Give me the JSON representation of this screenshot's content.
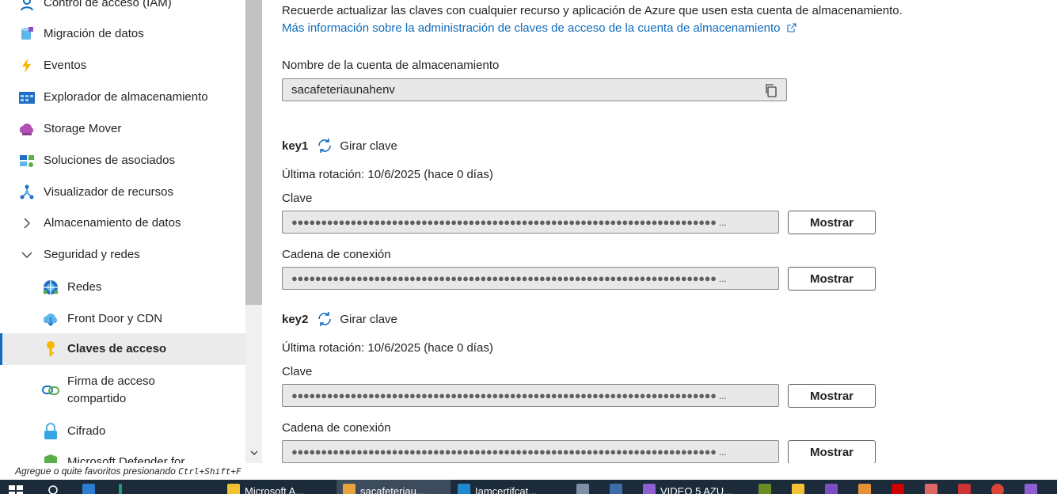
{
  "sidebar": {
    "items": [
      {
        "label": "Control de acceso (IAM)",
        "icon": "access-control-icon"
      },
      {
        "label": "Migración de datos",
        "icon": "data-migration-icon"
      },
      {
        "label": "Eventos",
        "icon": "events-icon"
      },
      {
        "label": "Explorador de almacenamiento",
        "icon": "storage-explorer-icon"
      },
      {
        "label": "Storage Mover",
        "icon": "storage-mover-icon"
      },
      {
        "label": "Soluciones de asociados",
        "icon": "partner-solutions-icon"
      },
      {
        "label": "Visualizador de recursos",
        "icon": "resource-visualizer-icon"
      },
      {
        "label": "Almacenamiento de datos",
        "icon": "chevron-right-icon"
      },
      {
        "label": "Seguridad y redes",
        "icon": "chevron-down-icon"
      },
      {
        "label": "Redes",
        "icon": "networking-icon"
      },
      {
        "label": "Front Door y CDN",
        "icon": "front-door-cdn-icon"
      },
      {
        "label": "Claves de acceso",
        "icon": "access-keys-icon"
      },
      {
        "label_line1": "Firma de acceso",
        "label_line2": "compartido",
        "icon": "shared-access-signature-icon"
      },
      {
        "label": "Cifrado",
        "icon": "encryption-icon"
      },
      {
        "label": "Microsoft Defender for",
        "icon": "defender-icon"
      }
    ]
  },
  "main": {
    "notice": "Recuerde actualizar las claves con cualquier recurso y aplicación de Azure que usen esta cuenta de almacenamiento.",
    "learn_more": "Más información sobre la administración de claves de acceso de la cuenta de almacenamiento",
    "account_name_label": "Nombre de la cuenta de almacenamiento",
    "account_name_value": "sacafeteriaunahenv",
    "keys": [
      {
        "name": "key1",
        "rotate_label": "Girar clave",
        "last_rotation": "Última rotación: 10/6/2025 (hace 0 días)",
        "key_label": "Clave",
        "key_masked": "●●●●●●●●●●●●●●●●●●●●●●●●●●●●●●●●●●●●●●●●●●●●●●●●●●●●●●●●●●●●●●●●●●●●●●●● ...",
        "show_label": "Mostrar",
        "conn_label": "Cadena de conexión",
        "conn_masked": "●●●●●●●●●●●●●●●●●●●●●●●●●●●●●●●●●●●●●●●●●●●●●●●●●●●●●●●●●●●●●●●●●●●●●●●● ..."
      },
      {
        "name": "key2",
        "rotate_label": "Girar clave",
        "last_rotation": "Última rotación: 10/6/2025 (hace 0 días)",
        "key_label": "Clave",
        "key_masked": "●●●●●●●●●●●●●●●●●●●●●●●●●●●●●●●●●●●●●●●●●●●●●●●●●●●●●●●●●●●●●●●●●●●●●●●● ...",
        "show_label": "Mostrar",
        "conn_label": "Cadena de conexión",
        "conn_masked": "●●●●●●●●●●●●●●●●●●●●●●●●●●●●●●●●●●●●●●●●●●●●●●●●●●●●●●●●●●●●●●●●●●●●●●●● ..."
      }
    ]
  },
  "statusbar": {
    "text": "Agregue o quite favoritos presionando ",
    "shortcut": "Ctrl+Shift+F"
  },
  "taskbar": {
    "items": [
      "Microsoft A...",
      "sacafeteriau...",
      "Iamcertifcat...",
      "VIDEO 5 AZU..."
    ]
  },
  "colors": {
    "accent": "#0f6cbd",
    "selected_bg": "#ebebeb",
    "taskbar_bg": "#1b2b3a"
  }
}
